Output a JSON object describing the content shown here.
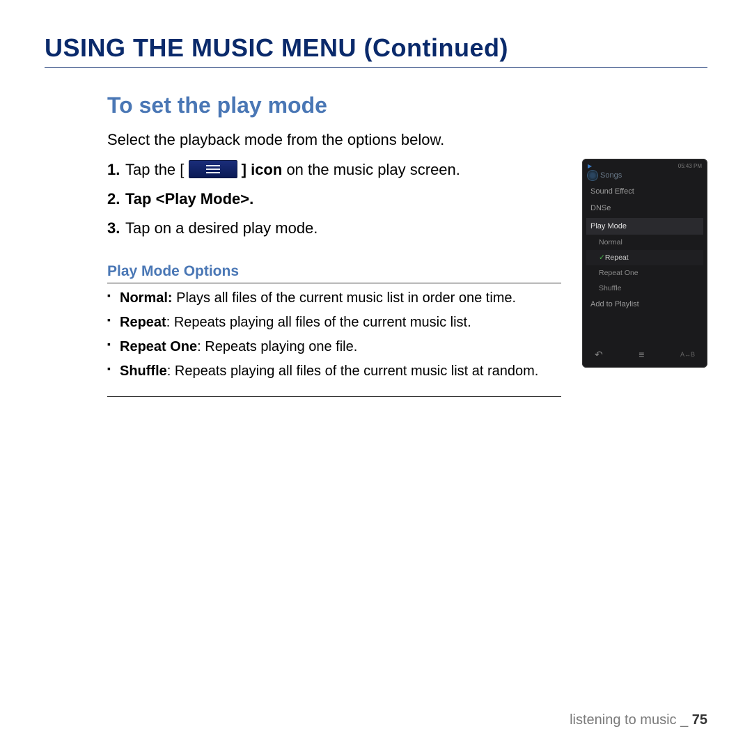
{
  "title": "USING THE MUSIC MENU (Continued)",
  "section": {
    "title": "To set the play mode",
    "intro": "Select the playback mode from the options below.",
    "steps": [
      {
        "num": "1.",
        "pre": "Tap the [ ",
        "post_bold": " ] icon",
        "post": " on the music play screen."
      },
      {
        "num": "2.",
        "bold_full": "Tap <Play Mode>."
      },
      {
        "num": "3.",
        "plain": "Tap on a desired play mode."
      }
    ],
    "options_title": "Play Mode Options",
    "options": [
      {
        "name": "Normal:",
        "desc": " Plays all files of the current music list in order one time."
      },
      {
        "name": "Repeat",
        "desc": ": Repeats playing all files of the current music list."
      },
      {
        "name": "Repeat One",
        "desc": ": Repeats playing one file."
      },
      {
        "name": "Shuffle",
        "desc": ": Repeats playing all files of the current music list at random."
      }
    ]
  },
  "device": {
    "status_time": "05:43 PM",
    "screen_title": "Songs",
    "menu": {
      "sound_effect": "Sound Effect",
      "dnse": "DNSe",
      "play_mode": "Play Mode",
      "items": [
        "Normal",
        "Repeat",
        "Repeat One",
        "Shuffle"
      ],
      "selected": "Repeat",
      "add_playlist": "Add to Playlist"
    },
    "bottom": {
      "back": "↶",
      "menu": "≡",
      "ab": "A↔B"
    }
  },
  "footer": {
    "label": "listening to music _ ",
    "page": "75"
  }
}
